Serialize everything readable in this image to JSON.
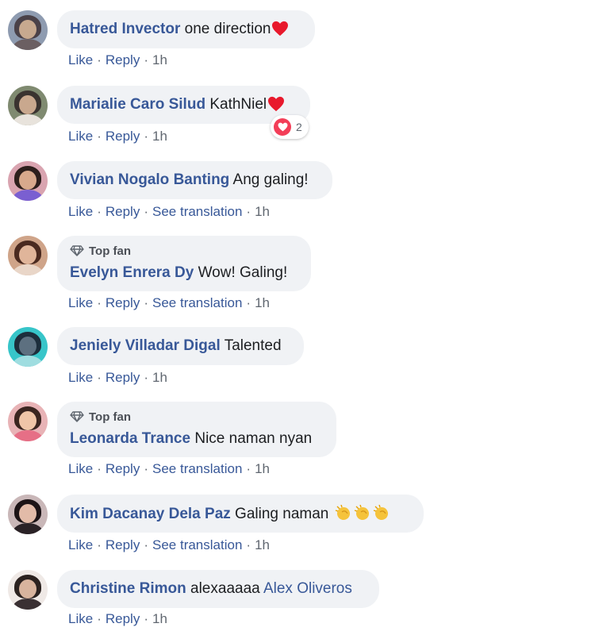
{
  "comments": [
    {
      "author": "Hatred Invector",
      "text": "one direction",
      "emoji": "heart",
      "top_fan": "",
      "actions": [
        "Like",
        "Reply"
      ],
      "time": "1h",
      "avatar_colors": {
        "bg": "#8e9bb0",
        "hair": "#4a4148",
        "skin": "#c7a98f",
        "body": "#6b5f62"
      }
    },
    {
      "author": "Marialie Caro Silud",
      "text": "KathNiel",
      "emoji": "heart",
      "top_fan": "",
      "actions": [
        "Like",
        "Reply"
      ],
      "time": "1h",
      "reaction": {
        "type": "love",
        "count": "2"
      },
      "avatar_colors": {
        "bg": "#7f8a70",
        "hair": "#3a3330",
        "skin": "#c9a88e",
        "body": "#e8e3dc"
      }
    },
    {
      "author": "Vivian Nogalo Banting",
      "text": "Ang galing!",
      "emoji": "",
      "top_fan": "",
      "actions": [
        "Like",
        "Reply",
        "See translation"
      ],
      "time": "1h",
      "avatar_colors": {
        "bg": "#d9a4b0",
        "hair": "#2d1f1c",
        "skin": "#d8a98c",
        "body": "#7a5fd1"
      }
    },
    {
      "author": "Evelyn Enrera Dy",
      "text": "Wow! Galing!",
      "emoji": "",
      "top_fan": "Top fan",
      "actions": [
        "Like",
        "Reply",
        "See translation"
      ],
      "time": "1h",
      "avatar_colors": {
        "bg": "#cfa489",
        "hair": "#4a2a20",
        "skin": "#e0b59a",
        "body": "#e9d6c8"
      }
    },
    {
      "author": "Jeniely Villadar Digal",
      "text": "Talented",
      "emoji": "",
      "top_fan": "",
      "actions": [
        "Like",
        "Reply"
      ],
      "time": "1h",
      "avatar_colors": {
        "bg": "#37c5c9",
        "hair": "#1d2e3c",
        "skin": "#5d7080",
        "body": "#9fdde0"
      }
    },
    {
      "author": "Leonarda Trance",
      "text": "Nice naman nyan",
      "emoji": "",
      "top_fan": "Top fan",
      "actions": [
        "Like",
        "Reply",
        "See translation"
      ],
      "time": "1h",
      "avatar_colors": {
        "bg": "#e8b3b6",
        "hair": "#3b2520",
        "skin": "#f0c5a8",
        "body": "#e66f86"
      }
    },
    {
      "author": "Kim Dacanay Dela Paz",
      "text": "Galing naman",
      "emoji": "claps",
      "top_fan": "",
      "actions": [
        "Like",
        "Reply",
        "See translation"
      ],
      "time": "1h",
      "avatar_colors": {
        "bg": "#c9b7b8",
        "hair": "#1c1416",
        "skin": "#e2bba8",
        "body": "#2a2226"
      }
    },
    {
      "author": "Christine Rimon",
      "text": "alexaaaaa",
      "mention": "Alex Oliveros",
      "emoji": "",
      "top_fan": "",
      "actions": [
        "Like",
        "Reply"
      ],
      "time": "1h",
      "avatar_colors": {
        "bg": "#efe9e6",
        "hair": "#2b2220",
        "skin": "#d8b49e",
        "body": "#3a3033"
      }
    }
  ],
  "colors": {
    "name_blue": "#385898",
    "bubble_bg": "#f0f2f5",
    "heart_red": "#e8192c",
    "love_pink": "#f33e58",
    "clap_yellow": "#f5c33b"
  }
}
